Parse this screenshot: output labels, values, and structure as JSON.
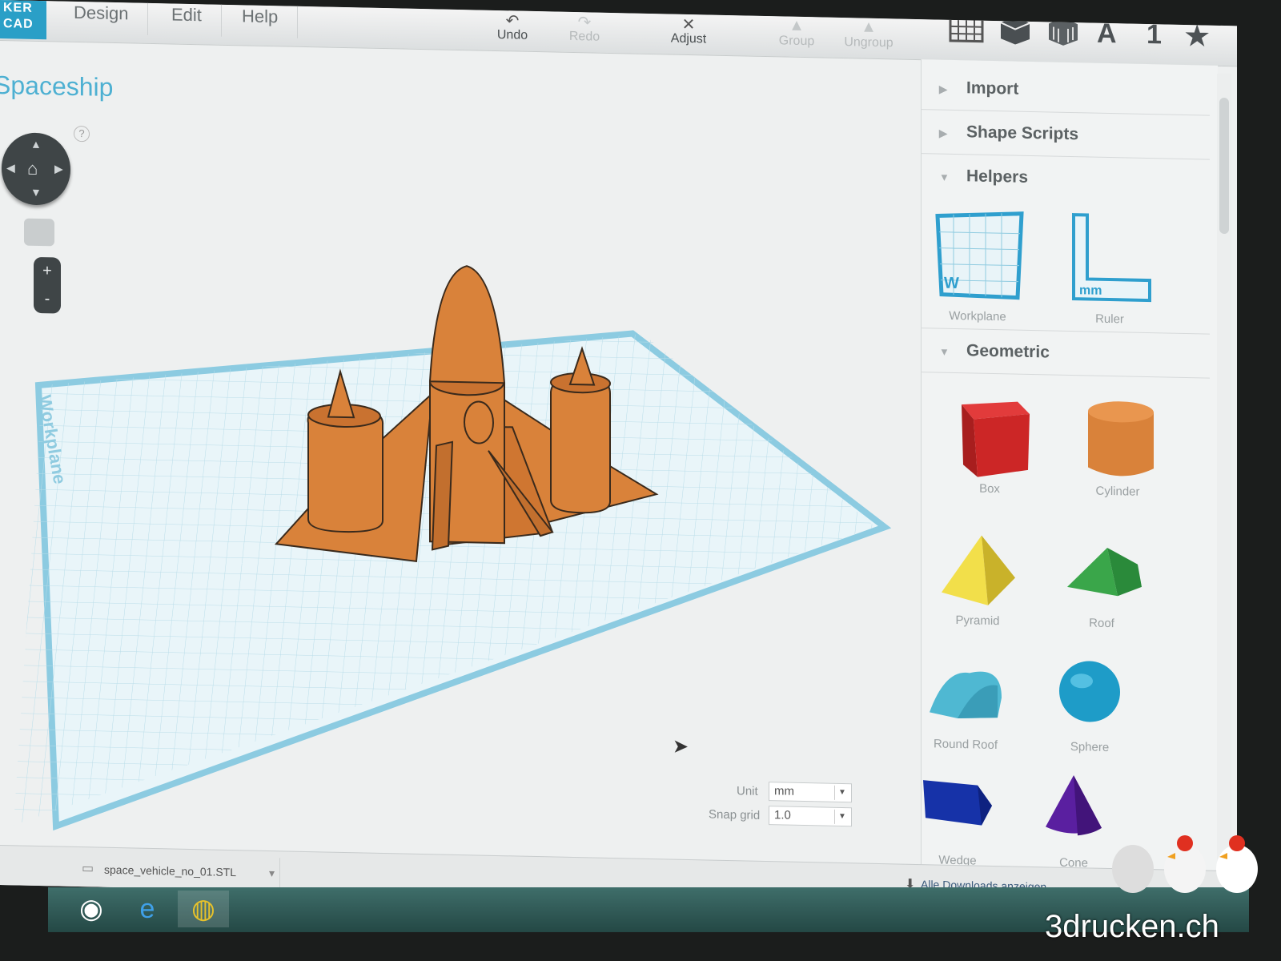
{
  "app": {
    "logo": "TINKERCAD",
    "logo_visible": "KER\nCAD"
  },
  "menu": {
    "design": "Design",
    "edit": "Edit",
    "help": "Help"
  },
  "toolbar": {
    "undo": "Undo",
    "redo": "Redo",
    "adjust": "Adjust",
    "group": "Group",
    "ungroup": "Ungroup",
    "icons": [
      "grid-view-icon",
      "box-view-icon",
      "crate-icon",
      "text-icon",
      "number-icon",
      "star-icon"
    ],
    "text_glyph": "A",
    "number_glyph": "1",
    "star_glyph": "★"
  },
  "project": {
    "title": "Spaceship"
  },
  "view_controls": {
    "help": "?",
    "zoom_in": "+",
    "zoom_out": "-"
  },
  "workplane": {
    "label": "Workplane"
  },
  "sidebar": {
    "import": "Import",
    "shape_scripts": "Shape Scripts",
    "helpers": {
      "title": "Helpers",
      "items": [
        "Workplane",
        "Ruler"
      ],
      "workplane_badge": "W",
      "ruler_badge": "mm"
    },
    "geometric": {
      "title": "Geometric",
      "items": [
        "Box",
        "Cylinder",
        "Pyramid",
        "Roof",
        "Round Roof",
        "Sphere",
        "Wedge",
        "Cone"
      ]
    }
  },
  "settings": {
    "unit_label": "Unit",
    "unit_value": "mm",
    "snap_label": "Snap grid",
    "snap_value": "1.0"
  },
  "downloads": {
    "file": "space_vehicle_no_01.STL",
    "show_all": "Alle Downloads anzeigen..."
  },
  "watermark": "3drucken.ch",
  "colors": {
    "accent": "#4db0d2",
    "model": "#d9823a",
    "grid": "#b9dde9"
  }
}
